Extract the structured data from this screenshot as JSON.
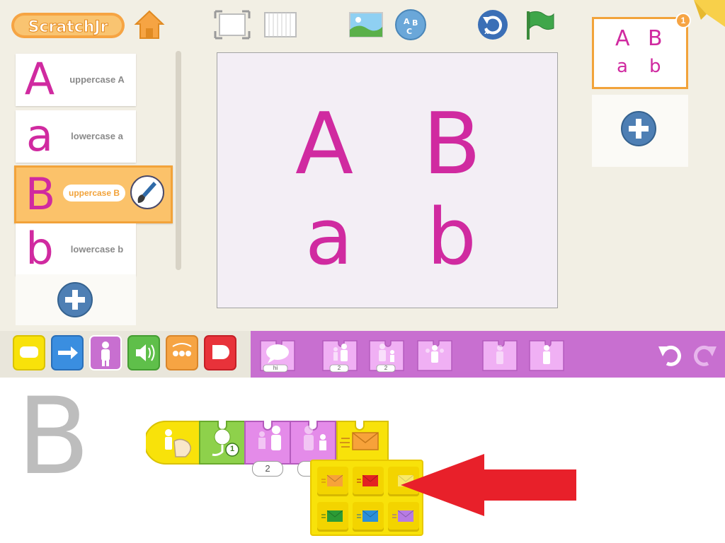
{
  "app": {
    "logo_text": "ScratchJr"
  },
  "sprites": [
    {
      "letter": "A",
      "label": "uppercase A",
      "selected": false
    },
    {
      "letter": "a",
      "label": "lowercase a",
      "selected": false
    },
    {
      "letter": "B",
      "label": "uppercase B",
      "selected": true
    },
    {
      "letter": "b",
      "label": "lowercase b",
      "selected": false
    }
  ],
  "stage": {
    "letters": [
      "A",
      "B",
      "a",
      "b"
    ]
  },
  "pages": {
    "current_number": "1",
    "thumb_letters": [
      "A",
      "B",
      "a",
      "b"
    ]
  },
  "palette": {
    "categories": [
      "triggering",
      "motion",
      "looks",
      "sound",
      "control",
      "end"
    ],
    "active_category": "looks",
    "blocks": [
      {
        "name": "say-block",
        "label": "hi"
      },
      {
        "name": "grow-block",
        "label": "2"
      },
      {
        "name": "shrink-block",
        "label": "2"
      },
      {
        "name": "reset-size-block",
        "label": ""
      },
      {
        "name": "hide-block",
        "label": ""
      },
      {
        "name": "show-block",
        "label": ""
      }
    ]
  },
  "script": {
    "sprite_letter": "B",
    "record_sound_number": "1",
    "grow_value": "2",
    "shrink_value": "2"
  },
  "colors": {
    "looks": "#c86fd0",
    "trigger": "#f8e20a",
    "sound": "#8ed14b",
    "highlight": "#f2a33a",
    "arrow": "#e8202a"
  },
  "message_colors": [
    "#f7a23a",
    "#e32222",
    "#f8e96a",
    "#2c9b35",
    "#2a8fd9",
    "#b77be3"
  ]
}
